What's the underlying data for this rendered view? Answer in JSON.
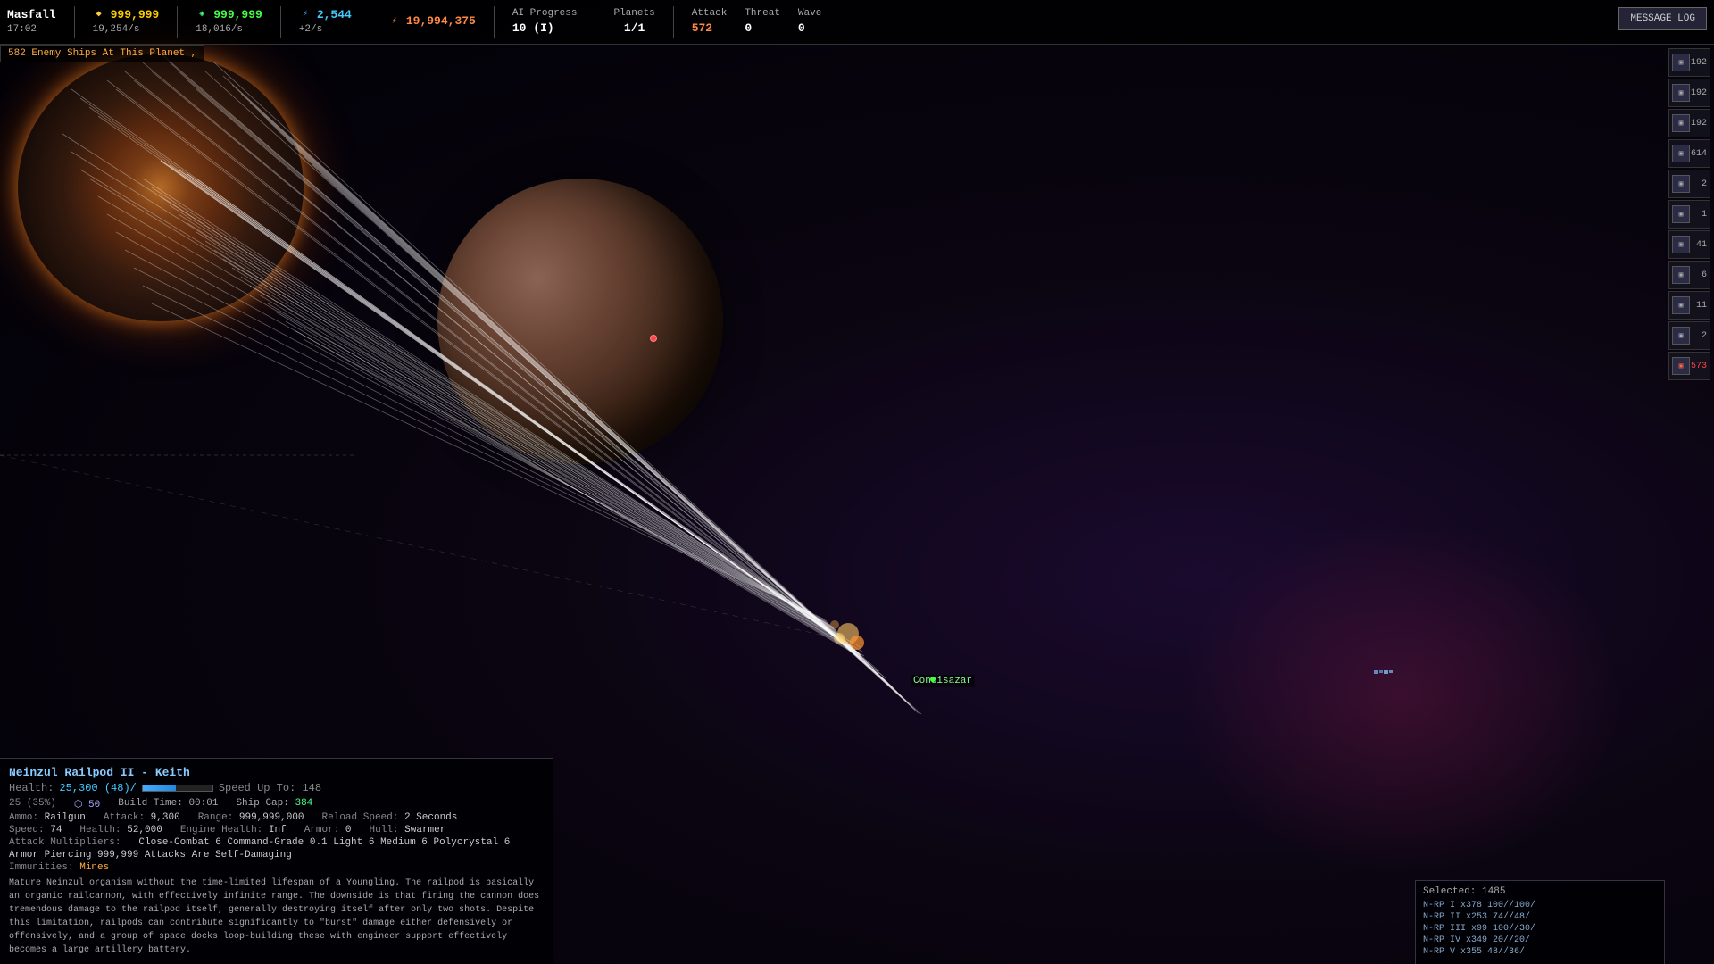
{
  "header": {
    "planet_name": "Masfall",
    "time": "17:02",
    "metal_current": "999,999",
    "metal_rate": "19,254/s",
    "crystal_current": "999,999",
    "crystal_rate": "18,016/s",
    "science_current": "2,544",
    "science_rate": "+2/s",
    "energy_current": "19,994,375",
    "ai_progress_label": "AI Progress",
    "ai_progress_value": "10 (I)",
    "planets_label": "Planets",
    "planets_value": "1/1",
    "attack_label": "Attack",
    "attack_value": "572",
    "threat_label": "Threat",
    "threat_value": "0",
    "wave_label": "Wave",
    "wave_value": "0",
    "message_log_btn": "MESSAGE LOG"
  },
  "enemy_count": "582 Enemy Ships At This Planet ,",
  "ship_info": {
    "name": "Neinzul Railpod II - Keith",
    "health_current": "25,300",
    "health_pct": "48",
    "health_max": "52,000",
    "speed_up_to": "Speed Up To: 148",
    "shield_icon": "⬡",
    "shield_value": "50",
    "build_time": "Build Time: 00:01",
    "ship_cap_label": "Ship Cap:",
    "ship_cap": "384",
    "progress_values": "25 (35%)",
    "ammo_label": "Ammo:",
    "ammo_value": "Railgun",
    "attack_label": "Attack:",
    "attack_value": "9,300",
    "range_label": "Range:",
    "range_value": "999,999,000",
    "reload_label": "Reload Speed:",
    "reload_value": "2 Seconds",
    "speed_label": "Speed:",
    "speed_value": "74",
    "health_label": "Health:",
    "health_stat": "52,000",
    "engine_label": "Engine Health:",
    "engine_value": "Inf",
    "armor_label": "Armor:",
    "armor_value": "0",
    "hull_label": "Hull:",
    "hull_value": "Swarmer",
    "attack_mult_label": "Attack Multipliers:",
    "attack_mult": "Close-Combat 6   Command-Grade 0.1   Light 6   Medium 6   Polycrystal 6",
    "armor_piercing": "Armor Piercing 999,999   Attacks Are Self-Damaging",
    "immunities_label": "Immunities:",
    "immunities_value": "Mines",
    "description": "Mature Neinzul organism without the time-limited lifespan of a Youngling. The railpod is basically an organic railcannon, with effectively infinite range. The downside is that firing the cannon does tremendous damage to the railpod itself, generally destroying itself after only two shots. Despite this limitation, railpods can contribute significantly to \"burst\" damage either defensively or offensively, and a group of space docks loop-building these with engineer support effectively becomes a large artillery battery."
  },
  "selected_panel": {
    "title": "Selected: 1485",
    "items": [
      "N-RP I x378  100//100/",
      "N-RP II x253  74//48/",
      "N-RP III x99  100//30/",
      "N-RP IV x349  20//20/",
      "N-RP V x355  48//36/"
    ]
  },
  "sidebar_units": [
    {
      "count": "192",
      "color": "default"
    },
    {
      "count": "192",
      "color": "default"
    },
    {
      "count": "192",
      "color": "default"
    },
    {
      "count": "614",
      "color": "default"
    },
    {
      "count": "2",
      "color": "default"
    },
    {
      "count": "1",
      "color": "default"
    },
    {
      "count": "41",
      "color": "default"
    },
    {
      "count": "6",
      "color": "default"
    },
    {
      "count": "11",
      "color": "default"
    },
    {
      "count": "2",
      "color": "default"
    },
    {
      "count": "573",
      "color": "red"
    }
  ],
  "concisazar_label": "Concisazar",
  "icons": {
    "metal": "◆",
    "crystal": "◈",
    "science": "⚡",
    "energy": "⚡",
    "ai": "◉"
  }
}
